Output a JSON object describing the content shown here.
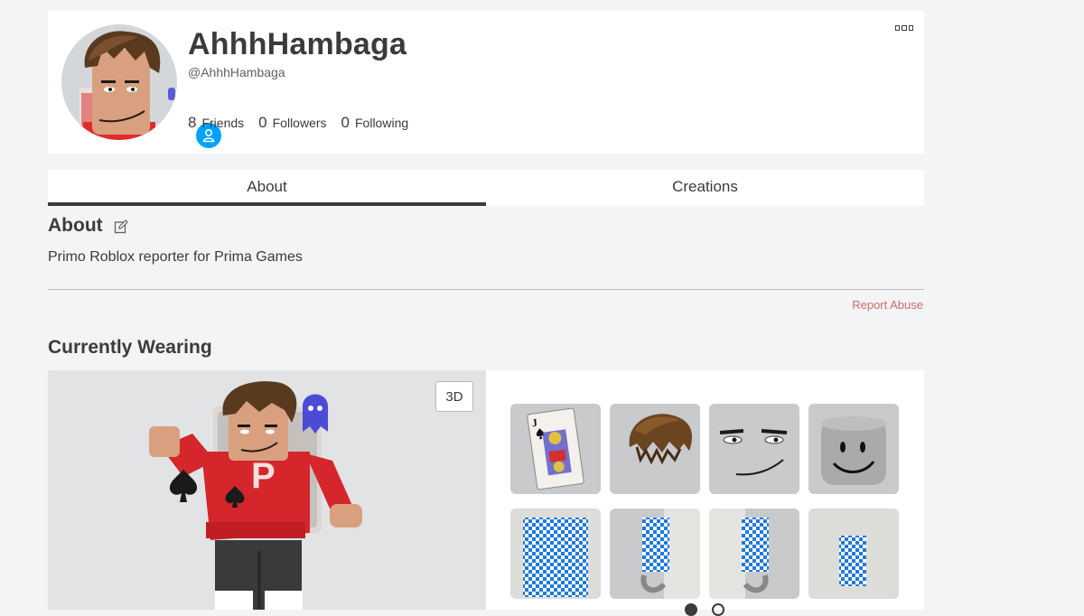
{
  "profile": {
    "display_name": "AhhhHambaga",
    "username": "@AhhhHambaga",
    "stats": [
      {
        "count": "8",
        "label": "Friends"
      },
      {
        "count": "0",
        "label": "Followers"
      },
      {
        "count": "0",
        "label": "Following"
      }
    ],
    "online_badge_icon": "person-icon",
    "more_icon": "more-options-icon"
  },
  "tabs": [
    {
      "label": "About",
      "active": true
    },
    {
      "label": "Creations",
      "active": false
    }
  ],
  "about": {
    "title": "About",
    "edit_icon": "edit-icon",
    "description": "Primo Roblox reporter for Prima Games",
    "report_label": "Report Abuse"
  },
  "wearing": {
    "title": "Currently Wearing",
    "view_toggle_label": "3D",
    "items": [
      {
        "name": "spade-card-back-accessory-icon"
      },
      {
        "name": "brown-hair-icon"
      },
      {
        "name": "smug-face-icon"
      },
      {
        "name": "default-head-icon"
      },
      {
        "name": "blue-checkered-shirt-icon"
      },
      {
        "name": "left-arm-icon"
      },
      {
        "name": "right-arm-icon"
      },
      {
        "name": "blue-checkered-leg-icon"
      }
    ],
    "pages": 2,
    "current_page": 1
  },
  "colors": {
    "background": "#f2f4f5",
    "card": "#ffffff",
    "text": "#393b3d",
    "report": "#d86868",
    "badge": "#00a2ff",
    "shirt": "#d4262b",
    "check_blue": "#1f7ae0"
  }
}
